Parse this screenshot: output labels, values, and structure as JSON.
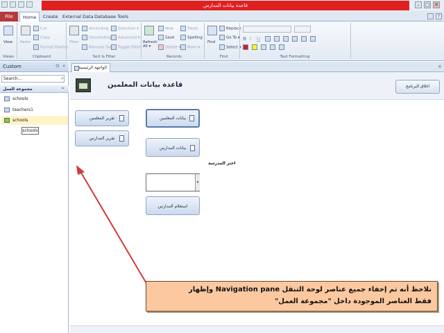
{
  "window": {
    "title": "قاعدة بيانات المدارس",
    "minimize": "–",
    "maximize": "□",
    "close": "✕"
  },
  "ribbon_tabs": [
    "File",
    "Home",
    "Create",
    "External Data",
    "Database Tools"
  ],
  "ribbon": {
    "views": {
      "view": "View",
      "group": "Views"
    },
    "clipboard": {
      "paste": "Paste",
      "cut": "Cut",
      "copy": "Copy",
      "format_painter": "Format Painter",
      "group": "Clipboard"
    },
    "sort_filter": {
      "filter": "Filter",
      "ascending": "Ascending",
      "descending": "Descending",
      "remove_sort": "Remove Sort",
      "selection": "Selection ▾",
      "advanced": "Advanced ▾",
      "toggle_filter": "Toggle Filter",
      "group": "Sort & Filter"
    },
    "records": {
      "refresh": "Refresh",
      "refresh_all": "All ▾",
      "new": "New",
      "save": "Save",
      "delete": "Delete ▾",
      "totals": "Totals",
      "spelling": "Spelling",
      "more": "More ▾",
      "group": "Records"
    },
    "find": {
      "find": "Find",
      "replace": "Replace",
      "goto": "Go To ▾",
      "select": "Select ▾",
      "group": "Find"
    },
    "text_formatting": {
      "group": "Text Formatting",
      "bold": "B",
      "italic": "I",
      "underline": "U"
    }
  },
  "nav_pane": {
    "title": "Custom",
    "search_placeholder": "Search...",
    "group_title": "مجموعة العمل",
    "items": [
      "schools",
      "teachers1",
      "schools"
    ],
    "tooltip": "schools"
  },
  "document": {
    "tab_label": "الواجهة الرئيسية",
    "form_title": "قاعدة بيانات المعلمين",
    "close_app": "اغلاق البرنامج",
    "buttons": {
      "teachers_report": "تقرير المعلمين",
      "schools_report": "تقرير المدارس",
      "teachers_data": "بيانات المعلمين",
      "schools_data": "بيانات المدارس",
      "query_schools": "استعلام المدارس"
    },
    "school_label": "اختر المدرسة",
    "combo_value": ""
  },
  "annotation": {
    "line1": "نلاحظ أنه تم إخفاء جميع عناصر لوحة التنقل Navigation pane وإظهار",
    "line2": "فقط العناصر الموجودة داخل \"مجموعة العمل\""
  },
  "colors": {
    "title_red": "#e02020",
    "file_tab": "#b5383b",
    "note_bg": "#fbc8a0",
    "arrow": "#d23a3a"
  }
}
